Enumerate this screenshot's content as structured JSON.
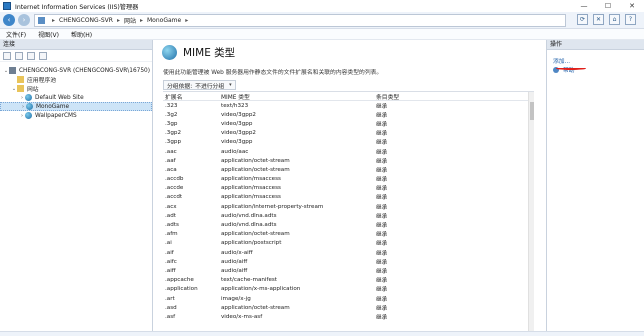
{
  "window": {
    "title": "Internet Information Services (IIS)管理器",
    "controls": [
      "—",
      "☐",
      "✕"
    ]
  },
  "address": {
    "crumbs": [
      "CHENGCONG-SVR",
      "网站",
      "MonoGame"
    ]
  },
  "menu": [
    "文件(F)",
    "视图(V)",
    "帮助(H)"
  ],
  "connections": {
    "header": "连接",
    "tree": [
      {
        "label": "CHENGCONG-SVR (CHENGCONG-SVR\\16750)",
        "icon": "server",
        "indent": 0,
        "twisty": "⌄"
      },
      {
        "label": "应用程序池",
        "icon": "folder",
        "indent": 1,
        "twisty": ""
      },
      {
        "label": "网站",
        "icon": "folder",
        "indent": 1,
        "twisty": "⌄"
      },
      {
        "label": "Default Web Site",
        "icon": "globe",
        "indent": 2,
        "twisty": "›"
      },
      {
        "label": "MonoGame",
        "icon": "globe",
        "indent": 2,
        "twisty": "›",
        "selected": true
      },
      {
        "label": "WallpaperCMS",
        "icon": "globe",
        "indent": 2,
        "twisty": "›"
      }
    ]
  },
  "feature": {
    "title": "MIME 类型",
    "description": "使用此功能管理被 Web 服务器用作静态文件的文件扩展名和关联的内容类型的列表。",
    "group_by_label": "分组依据:",
    "group_by_value": "不进行分组",
    "columns": [
      "扩展名",
      "MIME 类型",
      "条目类型"
    ],
    "rows": [
      [
        ".323",
        "text/h323",
        "继承"
      ],
      [
        ".3g2",
        "video/3gpp2",
        "继承"
      ],
      [
        ".3gp",
        "video/3gpp",
        "继承"
      ],
      [
        ".3gp2",
        "video/3gpp2",
        "继承"
      ],
      [
        ".3gpp",
        "video/3gpp",
        "继承"
      ],
      [
        ".aac",
        "audio/aac",
        "继承"
      ],
      [
        ".aaf",
        "application/octet-stream",
        "继承"
      ],
      [
        ".aca",
        "application/octet-stream",
        "继承"
      ],
      [
        ".accdb",
        "application/msaccess",
        "继承"
      ],
      [
        ".accde",
        "application/msaccess",
        "继承"
      ],
      [
        ".accdt",
        "application/msaccess",
        "继承"
      ],
      [
        ".acx",
        "application/internet-property-stream",
        "继承"
      ],
      [
        ".adt",
        "audio/vnd.dlna.adts",
        "继承"
      ],
      [
        ".adts",
        "audio/vnd.dlna.adts",
        "继承"
      ],
      [
        ".afm",
        "application/octet-stream",
        "继承"
      ],
      [
        ".ai",
        "application/postscript",
        "继承"
      ],
      [
        ".aif",
        "audio/x-aiff",
        "继承"
      ],
      [
        ".aifc",
        "audio/aiff",
        "继承"
      ],
      [
        ".aiff",
        "audio/aiff",
        "继承"
      ],
      [
        ".appcache",
        "text/cache-manifest",
        "继承"
      ],
      [
        ".application",
        "application/x-ms-application",
        "继承"
      ],
      [
        ".art",
        "image/x-jg",
        "继承"
      ],
      [
        ".asd",
        "application/octet-stream",
        "继承"
      ],
      [
        ".asf",
        "video/x-ms-asf",
        "继承"
      ]
    ]
  },
  "actions": {
    "header": "操作",
    "items": [
      "添加...",
      "帮助"
    ]
  }
}
